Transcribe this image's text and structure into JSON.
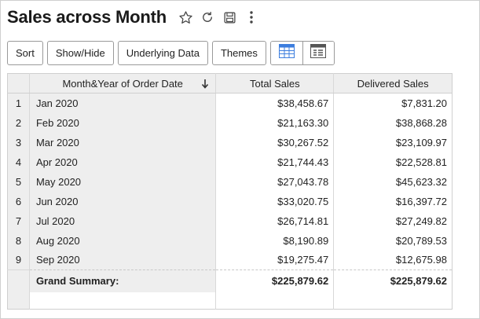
{
  "report": {
    "title": "Sales across Month"
  },
  "toolbar": {
    "sort": "Sort",
    "show_hide": "Show/Hide",
    "underlying_data": "Underlying Data",
    "themes": "Themes"
  },
  "icons": {
    "favorite": "star-icon",
    "refresh": "refresh-icon",
    "save": "save-icon",
    "more": "more-vertical-icon",
    "table_view": "table-view-icon",
    "summary_view": "summary-view-icon"
  },
  "table": {
    "headers": {
      "month": "Month&Year of Order Date",
      "sales": "Total Sales",
      "delivered": "Delivered Sales"
    },
    "rows": [
      {
        "idx": "1",
        "month": "Jan 2020",
        "sales": "$38,458.67",
        "delivered": "$7,831.20"
      },
      {
        "idx": "2",
        "month": "Feb 2020",
        "sales": "$21,163.30",
        "delivered": "$38,868.28"
      },
      {
        "idx": "3",
        "month": "Mar 2020",
        "sales": "$30,267.52",
        "delivered": "$23,109.97"
      },
      {
        "idx": "4",
        "month": "Apr 2020",
        "sales": "$21,744.43",
        "delivered": "$22,528.81"
      },
      {
        "idx": "5",
        "month": "May 2020",
        "sales": "$27,043.78",
        "delivered": "$45,623.32"
      },
      {
        "idx": "6",
        "month": "Jun 2020",
        "sales": "$33,020.75",
        "delivered": "$16,397.72"
      },
      {
        "idx": "7",
        "month": "Jul 2020",
        "sales": "$26,714.81",
        "delivered": "$27,249.82"
      },
      {
        "idx": "8",
        "month": "Aug 2020",
        "sales": "$8,190.89",
        "delivered": "$20,789.53"
      },
      {
        "idx": "9",
        "month": "Sep 2020",
        "sales": "$19,275.47",
        "delivered": "$12,675.98"
      }
    ],
    "summary": {
      "label": "Grand Summary:",
      "sales": "$225,879.62",
      "delivered": "$225,879.62"
    }
  },
  "colors": {
    "header_bg": "#eeeeee",
    "view_icon_accent": "#3d7ede"
  }
}
